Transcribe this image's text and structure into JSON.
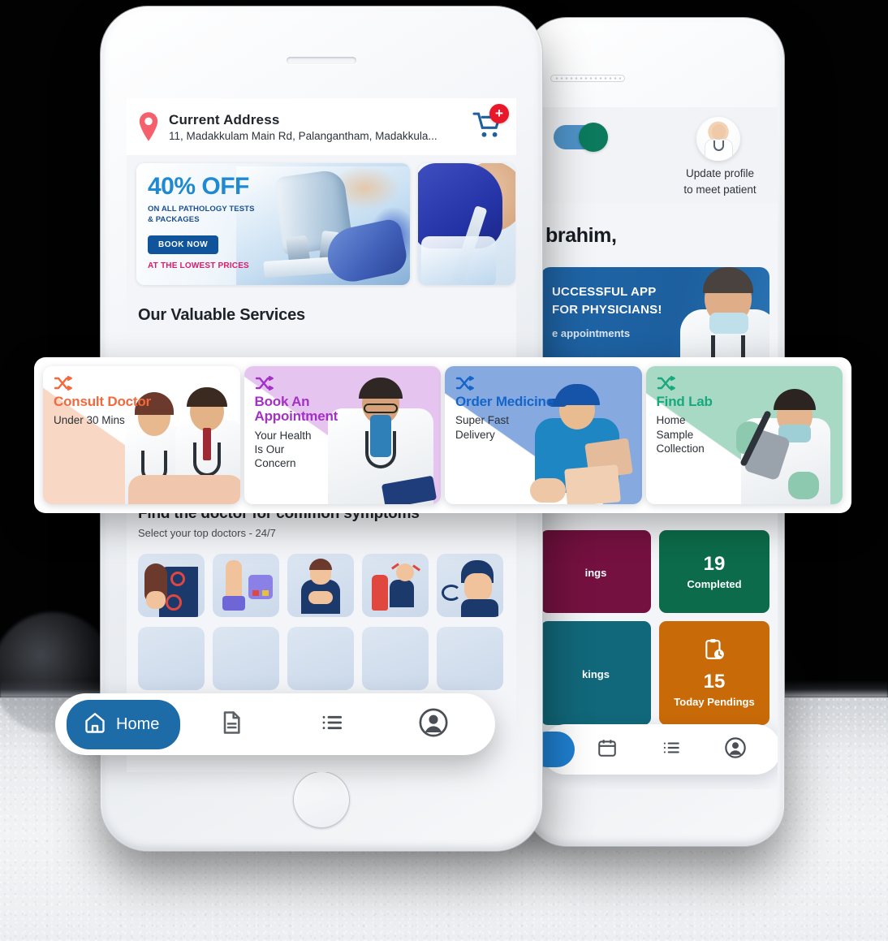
{
  "patient_app": {
    "address": {
      "icon": "location-pin-icon",
      "title": "Current Address",
      "value": "11, Madakkulam Main Rd, Palangantham, Madakkula...",
      "cart_icon": "shopping-cart-icon",
      "cart_badge": "+"
    },
    "promo_banner": {
      "headline": "40% OFF",
      "subline_1": "ON ALL PATHOLOGY TESTS",
      "subline_2": "& PACKAGES",
      "cta": "BOOK NOW",
      "footnote": "AT THE LOWEST PRICES",
      "headline_color": "#1f8ad1",
      "cta_color": "#10549c",
      "footnote_color": "#e01a6b"
    },
    "services_heading": "Our Valuable Services",
    "symptoms": {
      "title": "Find the doctor for common symptoms",
      "subtitle": "Select your top doctors - 24/7",
      "tiles": [
        "back-pain-symptom-icon",
        "blood-pressure-symptom-icon",
        "stomach-pain-symptom-icon",
        "digestive-symptom-icon",
        "sneezing-allergy-symptom-icon"
      ]
    },
    "bottom_nav": {
      "active_label": "Home",
      "active_color": "#1d6ca8",
      "items": [
        {
          "icon": "home-icon",
          "label": "Home",
          "active": true
        },
        {
          "icon": "document-icon",
          "label": "",
          "active": false
        },
        {
          "icon": "list-icon",
          "label": "",
          "active": false
        },
        {
          "icon": "profile-icon",
          "label": "",
          "active": false
        }
      ]
    }
  },
  "services": [
    {
      "icon": "shuffle-icon",
      "name": "Consult Doctor",
      "desc": "Under 30 Mins",
      "color": "#f4683c",
      "wedge": "#f8d7c5",
      "art": "two-doctors-photo"
    },
    {
      "icon": "shuffle-icon",
      "name": "Book An Appointment",
      "desc": "Your Health Is Our Concern",
      "color": "#a331c6",
      "wedge": "#e6c4f0",
      "art": "doctor-with-clipboard-photo"
    },
    {
      "icon": "shuffle-icon",
      "name": "Order Medicine",
      "desc": "Super Fast Delivery",
      "color": "#1565c8",
      "wedge": "#86aae0",
      "art": "delivery-man-photo"
    },
    {
      "icon": "shuffle-icon",
      "name": "Find Lab",
      "desc": "Home Sample Collection",
      "color": "#17a97e",
      "wedge": "#a8d9c4",
      "art": "lab-technician-photo"
    }
  ],
  "doctor_app": {
    "availability_toggle": {
      "name": "availability-toggle",
      "state": "on",
      "track_color": "#4f93c8",
      "knob_color": "#0b7a5d"
    },
    "profile": {
      "avatar": "doctor-avatar",
      "caption_line_1": "Update profile",
      "caption_line_2": "to meet patient"
    },
    "greeting": "brahim,",
    "promo_banner": {
      "line_1": "UCCESSFUL APP",
      "line_2": "FOR PHYSICIANS!",
      "line_3": "e appointments",
      "background_color": "#1f66a8"
    },
    "stats": [
      {
        "num": "",
        "label": "ings",
        "color": "#751140"
      },
      {
        "num": "19",
        "label": "Completed",
        "color": "#0c6b4a"
      },
      {
        "num": "",
        "label": "kings",
        "color": "#11687a"
      },
      {
        "num": "15",
        "label": "Today Pendings",
        "color": "#c96a08",
        "icon": "clipboard-clock-icon"
      }
    ],
    "bottom_nav": {
      "active_color": "#1f7fd0",
      "items": [
        {
          "icon": "home-icon",
          "active": true
        },
        {
          "icon": "calendar-icon",
          "active": false
        },
        {
          "icon": "list-icon",
          "active": false
        },
        {
          "icon": "profile-icon",
          "active": false
        }
      ]
    }
  }
}
